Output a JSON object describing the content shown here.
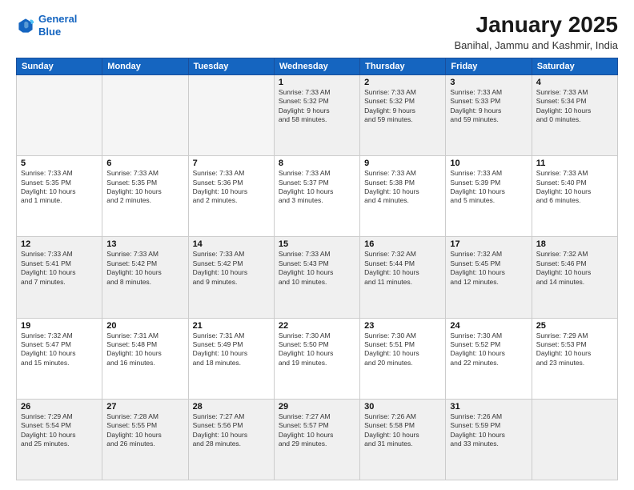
{
  "header": {
    "logo_line1": "General",
    "logo_line2": "Blue",
    "title": "January 2025",
    "subtitle": "Banihal, Jammu and Kashmir, India"
  },
  "weekdays": [
    "Sunday",
    "Monday",
    "Tuesday",
    "Wednesday",
    "Thursday",
    "Friday",
    "Saturday"
  ],
  "weeks": [
    [
      {
        "day": "",
        "info": "",
        "empty": true
      },
      {
        "day": "",
        "info": "",
        "empty": true
      },
      {
        "day": "",
        "info": "",
        "empty": true
      },
      {
        "day": "1",
        "info": "Sunrise: 7:33 AM\nSunset: 5:32 PM\nDaylight: 9 hours\nand 58 minutes.",
        "empty": false
      },
      {
        "day": "2",
        "info": "Sunrise: 7:33 AM\nSunset: 5:32 PM\nDaylight: 9 hours\nand 59 minutes.",
        "empty": false
      },
      {
        "day": "3",
        "info": "Sunrise: 7:33 AM\nSunset: 5:33 PM\nDaylight: 9 hours\nand 59 minutes.",
        "empty": false
      },
      {
        "day": "4",
        "info": "Sunrise: 7:33 AM\nSunset: 5:34 PM\nDaylight: 10 hours\nand 0 minutes.",
        "empty": false
      }
    ],
    [
      {
        "day": "5",
        "info": "Sunrise: 7:33 AM\nSunset: 5:35 PM\nDaylight: 10 hours\nand 1 minute.",
        "empty": false
      },
      {
        "day": "6",
        "info": "Sunrise: 7:33 AM\nSunset: 5:35 PM\nDaylight: 10 hours\nand 2 minutes.",
        "empty": false
      },
      {
        "day": "7",
        "info": "Sunrise: 7:33 AM\nSunset: 5:36 PM\nDaylight: 10 hours\nand 2 minutes.",
        "empty": false
      },
      {
        "day": "8",
        "info": "Sunrise: 7:33 AM\nSunset: 5:37 PM\nDaylight: 10 hours\nand 3 minutes.",
        "empty": false
      },
      {
        "day": "9",
        "info": "Sunrise: 7:33 AM\nSunset: 5:38 PM\nDaylight: 10 hours\nand 4 minutes.",
        "empty": false
      },
      {
        "day": "10",
        "info": "Sunrise: 7:33 AM\nSunset: 5:39 PM\nDaylight: 10 hours\nand 5 minutes.",
        "empty": false
      },
      {
        "day": "11",
        "info": "Sunrise: 7:33 AM\nSunset: 5:40 PM\nDaylight: 10 hours\nand 6 minutes.",
        "empty": false
      }
    ],
    [
      {
        "day": "12",
        "info": "Sunrise: 7:33 AM\nSunset: 5:41 PM\nDaylight: 10 hours\nand 7 minutes.",
        "empty": false
      },
      {
        "day": "13",
        "info": "Sunrise: 7:33 AM\nSunset: 5:42 PM\nDaylight: 10 hours\nand 8 minutes.",
        "empty": false
      },
      {
        "day": "14",
        "info": "Sunrise: 7:33 AM\nSunset: 5:42 PM\nDaylight: 10 hours\nand 9 minutes.",
        "empty": false
      },
      {
        "day": "15",
        "info": "Sunrise: 7:33 AM\nSunset: 5:43 PM\nDaylight: 10 hours\nand 10 minutes.",
        "empty": false
      },
      {
        "day": "16",
        "info": "Sunrise: 7:32 AM\nSunset: 5:44 PM\nDaylight: 10 hours\nand 11 minutes.",
        "empty": false
      },
      {
        "day": "17",
        "info": "Sunrise: 7:32 AM\nSunset: 5:45 PM\nDaylight: 10 hours\nand 12 minutes.",
        "empty": false
      },
      {
        "day": "18",
        "info": "Sunrise: 7:32 AM\nSunset: 5:46 PM\nDaylight: 10 hours\nand 14 minutes.",
        "empty": false
      }
    ],
    [
      {
        "day": "19",
        "info": "Sunrise: 7:32 AM\nSunset: 5:47 PM\nDaylight: 10 hours\nand 15 minutes.",
        "empty": false
      },
      {
        "day": "20",
        "info": "Sunrise: 7:31 AM\nSunset: 5:48 PM\nDaylight: 10 hours\nand 16 minutes.",
        "empty": false
      },
      {
        "day": "21",
        "info": "Sunrise: 7:31 AM\nSunset: 5:49 PM\nDaylight: 10 hours\nand 18 minutes.",
        "empty": false
      },
      {
        "day": "22",
        "info": "Sunrise: 7:30 AM\nSunset: 5:50 PM\nDaylight: 10 hours\nand 19 minutes.",
        "empty": false
      },
      {
        "day": "23",
        "info": "Sunrise: 7:30 AM\nSunset: 5:51 PM\nDaylight: 10 hours\nand 20 minutes.",
        "empty": false
      },
      {
        "day": "24",
        "info": "Sunrise: 7:30 AM\nSunset: 5:52 PM\nDaylight: 10 hours\nand 22 minutes.",
        "empty": false
      },
      {
        "day": "25",
        "info": "Sunrise: 7:29 AM\nSunset: 5:53 PM\nDaylight: 10 hours\nand 23 minutes.",
        "empty": false
      }
    ],
    [
      {
        "day": "26",
        "info": "Sunrise: 7:29 AM\nSunset: 5:54 PM\nDaylight: 10 hours\nand 25 minutes.",
        "empty": false
      },
      {
        "day": "27",
        "info": "Sunrise: 7:28 AM\nSunset: 5:55 PM\nDaylight: 10 hours\nand 26 minutes.",
        "empty": false
      },
      {
        "day": "28",
        "info": "Sunrise: 7:27 AM\nSunset: 5:56 PM\nDaylight: 10 hours\nand 28 minutes.",
        "empty": false
      },
      {
        "day": "29",
        "info": "Sunrise: 7:27 AM\nSunset: 5:57 PM\nDaylight: 10 hours\nand 29 minutes.",
        "empty": false
      },
      {
        "day": "30",
        "info": "Sunrise: 7:26 AM\nSunset: 5:58 PM\nDaylight: 10 hours\nand 31 minutes.",
        "empty": false
      },
      {
        "day": "31",
        "info": "Sunrise: 7:26 AM\nSunset: 5:59 PM\nDaylight: 10 hours\nand 33 minutes.",
        "empty": false
      },
      {
        "day": "",
        "info": "",
        "empty": true
      }
    ]
  ]
}
